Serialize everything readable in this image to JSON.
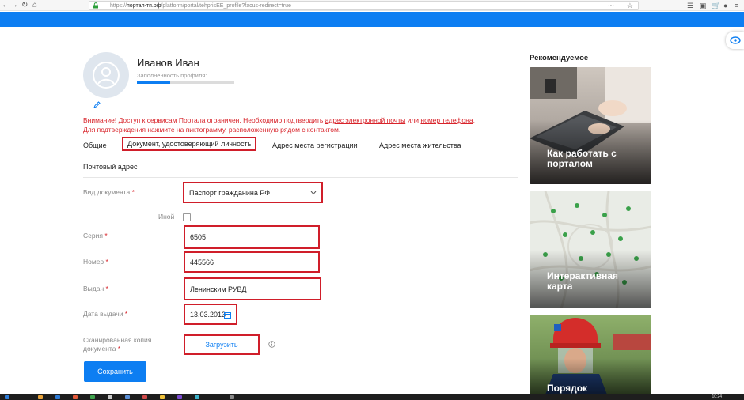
{
  "browser": {
    "url_prefix": "https://",
    "url_host": "портал-тп.рф",
    "url_path": "/platform/portal/tehprisEE_profile?facus-redirect=true",
    "dots": "···"
  },
  "profile": {
    "name": "Иванов Иван",
    "fill_label": "Заполненность профиля:",
    "fill_fraction": 0.34
  },
  "warning": {
    "part1": "Внимание! Доступ к сервисам Портала ограничен. Необходимо подтвердить ",
    "link_email": "адрес электронной почты",
    "part2": " или ",
    "link_phone": "номер телефона",
    "part3": ".",
    "line2": "Для подтверждения нажмите на пиктограмму, расположенную рядом с контактом."
  },
  "tabs": [
    {
      "label": "Общие"
    },
    {
      "label": "Документ, удостоверяющий личность"
    },
    {
      "label": "Адрес места регистрации"
    },
    {
      "label": "Адрес места жительства"
    },
    {
      "label": "Почтовый адрес"
    }
  ],
  "form": {
    "doc_type_label": "Вид документа",
    "doc_type_value": "Паспорт гражданина РФ",
    "other_label": "Иной",
    "series_label": "Серия",
    "series_value": "6505",
    "number_label": "Номер",
    "number_value": "445566",
    "issued_label": "Выдан",
    "issued_value": "Ленинским РУВД",
    "issue_date_label": "Дата выдачи",
    "issue_date_value": "13.03.2013",
    "scan_label_line1": "Сканированная копия",
    "scan_label_line2": "документа",
    "upload_label": "Загрузить",
    "save_label": "Сохранить",
    "required_mark": "*"
  },
  "sidebar": {
    "title": "Рекомендуемое",
    "cards": [
      {
        "line1": "Как работать с",
        "line2": "порталом"
      },
      {
        "line1": "Интерактивная",
        "line2": "карта"
      },
      {
        "line1": "Порядок",
        "line2": ""
      }
    ]
  },
  "taskbar": {
    "clock": "10:24"
  },
  "colors": {
    "accent": "#0d7ef2",
    "highlight": "#d01e2a",
    "warning_text": "#d8232a"
  }
}
